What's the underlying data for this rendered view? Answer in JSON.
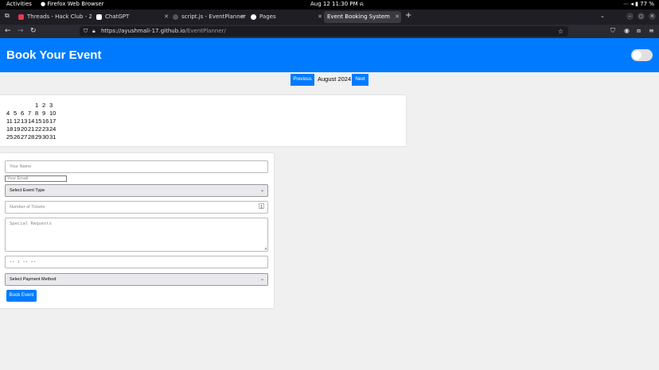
{
  "system_bar": {
    "activities": "Activities",
    "app": "Firefox Web Browser",
    "clock": "Aug 12  11:30 PM",
    "battery": "77 %"
  },
  "tabs": [
    {
      "label": "Threads - Hack Club - 2",
      "color": "#ec3750"
    },
    {
      "label": "ChatGPT",
      "color": "#ffffff"
    },
    {
      "label": "script.js - EventPlanner",
      "color": "#555555"
    },
    {
      "label": "Pages",
      "color": "#ffffff"
    },
    {
      "label": "Event Booking System",
      "color": ""
    }
  ],
  "url": {
    "host": "https://ayushmali-17.github.io",
    "path": "/EventPlanner/"
  },
  "header": {
    "title": "Book Your Event"
  },
  "calendar": {
    "prev_label": "Previous",
    "month_label": "August 2024",
    "next_label": "Next",
    "weeks": [
      [
        "",
        "",
        "",
        "",
        "1",
        "2",
        "3"
      ],
      [
        "4",
        "5",
        "6",
        "7",
        "8",
        "9",
        "10"
      ],
      [
        "11",
        "12",
        "13",
        "14",
        "15",
        "16",
        "17"
      ],
      [
        "18",
        "19",
        "20",
        "21",
        "22",
        "23",
        "24"
      ],
      [
        "25",
        "26",
        "27",
        "28",
        "29",
        "30",
        "31"
      ]
    ]
  },
  "form": {
    "name_placeholder": "Your Name",
    "email_placeholder": "Your Email",
    "event_type": "Select Event Type",
    "tickets_placeholder": "Number of Tickets",
    "requests_placeholder": "Special Requests",
    "time_value": "-- : --   --",
    "payment_method": "Select Payment Method",
    "submit_label": "Book Event"
  },
  "colors": {
    "accent": "#007bff",
    "page_bg": "#f0f0f0"
  }
}
